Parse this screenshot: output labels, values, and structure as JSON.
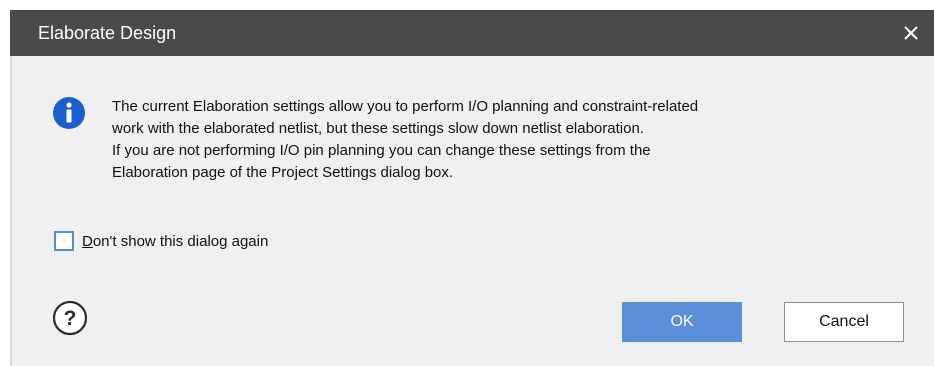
{
  "dialog": {
    "title": "Elaborate Design",
    "close_icon": "close-icon",
    "info_icon": "info-icon",
    "message_lines": [
      "The current Elaboration settings allow you to perform I/O planning and constraint-related",
      "work with the elaborated netlist, but these settings slow down netlist elaboration.",
      "If you are not performing I/O pin planning you can change these settings from the",
      "Elaboration page of the Project Settings dialog box."
    ],
    "checkbox": {
      "mnemonic": "D",
      "label_rest": "on't show this dialog again",
      "checked": false
    },
    "help_icon": "help-icon",
    "ok_label": "OK",
    "cancel_label": "Cancel"
  },
  "colors": {
    "titlebar": "#4a4a4a",
    "accent": "#5b8fd9",
    "info_icon": "#1a5fd0",
    "body_bg": "#f0f0f0"
  }
}
